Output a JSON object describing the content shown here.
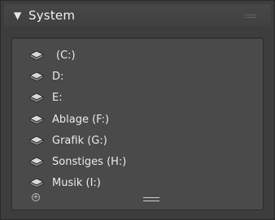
{
  "panel": {
    "title": "System",
    "collapse_icon": "triangle-down-icon",
    "grip_icon": "drag-grip-icon"
  },
  "drives": [
    {
      "label": " (C:)",
      "icon": "drive-icon"
    },
    {
      "label": "D:",
      "icon": "drive-icon"
    },
    {
      "label": "E:",
      "icon": "drive-icon"
    },
    {
      "label": "Ablage (F:)",
      "icon": "drive-icon"
    },
    {
      "label": "Grafik (G:)",
      "icon": "drive-icon"
    },
    {
      "label": "Sonstiges (H:)",
      "icon": "drive-icon"
    },
    {
      "label": "Musik (I:)",
      "icon": "drive-icon"
    }
  ],
  "controls": {
    "add_icon": "plus-circle-icon",
    "resize_icon": "resize-handle-icon"
  },
  "colors": {
    "background": "#3d3d3d",
    "list_background": "#4a4a4a",
    "text": "#eaeaea"
  }
}
